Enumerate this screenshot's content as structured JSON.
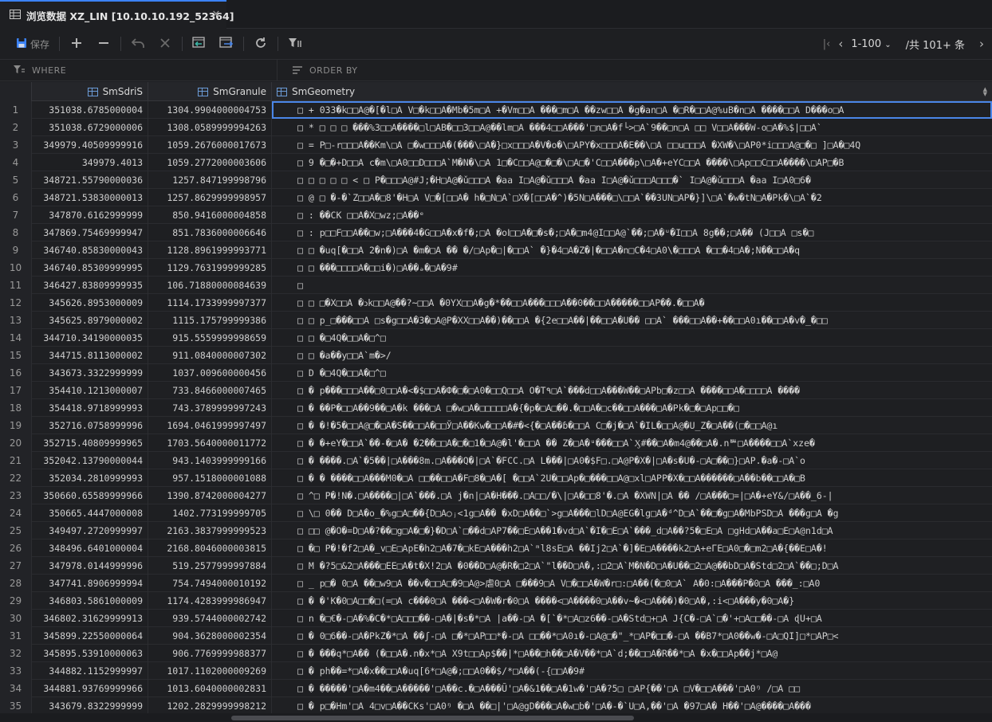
{
  "tab": {
    "title": "浏览数据 XZ_LIN [10.10.10.192_52364]",
    "icon": "table-icon",
    "close_icon": "close-icon"
  },
  "toolbar": {
    "save_label": "保存",
    "pager": {
      "range": "1-100",
      "total": "/共 101+ 条"
    }
  },
  "filter": {
    "where_label": "WHERE",
    "order_label": "ORDER BY"
  },
  "columns": [
    "SmSdriS",
    "SmGranule",
    "SmGeometry"
  ],
  "rows": [
    {
      "n": "1",
      "a": "351038.6785000004",
      "b": "1304.9904000004753",
      "c": "□    +    033�k□□A@�[�l□A V□�k□□A�Mb�5m□A +�Vm□□A ���□m□A ��zw□□A �g�an□A �□R�□□A@%uB�n□A ����□□A D���o□A"
    },
    {
      "n": "2",
      "a": "351038.6729000006",
      "b": "1308.0589999994263",
      "c": "□    *    □    □    □      ���%3□□A����□l□AB�□□3□□A@��lm□A ���4□□A���'□n□A�f└>□A`9��□n□A □□ V□□A���W-o□A�%$|□□A`"
    },
    {
      "n": "3",
      "a": "349979.40509999916",
      "b": "1059.2676000017673",
      "c": "□    =    P□-r□□□A��Km\\□A □�w□□□A�(���\\□A�}□x□□□A�V�o�\\□APY�x□□□A�E��\\□A □□u□□□A �XW�\\□AP0*i□□□A@□�□ ]□A�□4Q"
    },
    {
      "n": "4",
      "a": "349979.4013",
      "b": "1059.2772000003606",
      "c": "□    9    �□�+D□□A c�m\\□A0□□D□□□A`M�N�\\□A 1□�C□□A@□�□�\\□A□�'C□□A���p\\□A�+eYC□□A ����\\□Ap□□C□□A����\\□AP□�B"
    },
    {
      "n": "5",
      "a": "348721.55790000036",
      "b": "1257.847199998796",
      "c": "□    □    □    □    □    <    □    P�□□□A@#J;�H□A@�ǔ□□□A �aa I□A@�ǔ□□□A �aa I□A@�ǔ□□□A□□□�` I□A@�ǔ□□□A �aa I□A0□6�"
    },
    {
      "n": "6",
      "a": "348721.53830000013",
      "b": "1257.8629999998957",
      "c": "□    @    □    �-�`Z□□A�□8'�H□A V□�[□□A�    h�□N□A`□X�[□□A�^)�5N□A���□\\□□A`��3UN□AP�}]\\□A`�w�tN□A�Pk�\\□A`�2"
    },
    {
      "n": "7",
      "a": "347870.6162999999",
      "b": "850.9416000004858",
      "c": "□    :    ��CK       □□A�X□wz;□A��ᵉ"
    },
    {
      "n": "8",
      "a": "347869.75469999947",
      "b": "851.7836000006646",
      "c": "□    :    p□□F□□A��□w;□A���4�G□□A�x�f�;□A �oⅠ□□A�□�s�;□A�□m4@I□□A@`��;□A�ᵘ�I□□A 8g��;□A��       (J□□A □s�□"
    },
    {
      "n": "9",
      "a": "346740.85830000043",
      "b": "1128.8961999993771",
      "c": "□    □    �uq[�□□A 2�n�)□A �m�□A ��        �/□Ap�□|�□□A` �}�4□A�Z�|�□□A�n□C�4□A0\\�□□□A �□□�4□A�;N��□□A�q"
    },
    {
      "n": "10",
      "a": "346740.85309999995",
      "b": "1129.7631999999285",
      "c": "□    □    ���□□□□A�□□i�)□A��ₔ�□A�9#"
    },
    {
      "n": "11",
      "a": "346427.83809999935",
      "b": "106.71880000084639",
      "c": "□"
    },
    {
      "n": "12",
      "a": "345626.8953000009",
      "b": "1114.1733999997377",
      "c": "□    □     □�X□□A �ↄk□□A@��?~□□A �0YX□□A�g�*��□□A���□□□A��0��□□A�����□□AP��.�□□A�"
    },
    {
      "n": "13",
      "a": "345625.8979000002",
      "b": "1115.175799999386",
      "c": "□    □    p_□���□□A □s�g□□A�3�□A@P�XX□□A��)��□□A �{2e□□A��|��□□A�U�� □□A` ���□□A��+��□□A0ı��□□A�v�_�□□"
    },
    {
      "n": "14",
      "a": "344710.34190000035",
      "b": "915.5559999998659",
      "c": "□    □    �□4Q�□□A�□^□"
    },
    {
      "n": "15",
      "a": "344715.8113000002",
      "b": "911.0840000007302",
      "c": "□    □    �a��y□□A`m�>/"
    },
    {
      "n": "16",
      "a": "343673.3322999999",
      "b": "1037.009600000456",
      "c": "□    D    �□4Q�□□A�□^□"
    },
    {
      "n": "17",
      "a": "354410.1213000007",
      "b": "733.8466000007465",
      "c": "□    �     p���□□□A��□0□□A�<�$□□A�Ф�□�□A0�□□Q□□A O�T٩□A`���d□□A���W��□APb□�z□□A ����□□A�□□□□A ����"
    },
    {
      "n": "18",
      "a": "354418.9718999993",
      "b": "743.3789999997243",
      "c": "□    �      ��P�□□A��9��□A�k      ���□A □�w□A�□□□□□A�{�p�□A□��.�□□A�□c��□□A���□A�Pk�□�□Ap□□�□"
    },
    {
      "n": "19",
      "a": "352716.0758999996",
      "b": "1694.0461999997497",
      "c": "□    �     �!�5�□□A@□�□A�S��□□A�□□Ў□A��Kw�□□A�#�<{�□A��ɓ�□□A C□�j�□A`�IL�□□A@�U_Z�□A��(□�□□A@ı"
    },
    {
      "n": "20",
      "a": "352715.40809999965",
      "b": "1703.5640000011772",
      "c": "□    �     �+eY�□□A`��-�□A� �2��□□A�□�□1�□A@�l'�□□A �� Z�□A�ᵘ���□□A`Ӽ#��□A�m4@��□A�.nᄥ□A����□□A`xze�"
    },
    {
      "n": "21",
      "a": "352042.13790000044",
      "b": "943.1403999999166",
      "c": "□    �     ����.□A`�5��|□A���8m.□A���Q�|□A`�FCC.□A L���|□A0�$F□.□A@P�X�|□A�s�U�-□A□��□}□AP.�a�-□A`o"
    },
    {
      "n": "22",
      "a": "352034.2810999993",
      "b": "957.1518000001088",
      "c": "□    �     � ����□□A���M0�□A □□��□□A�F□8�□A�[ �□□A`2U�□□Ap�□���□□A@□xl□APP�X�□□A������□A��b��□□A�□B"
    },
    {
      "n": "23",
      "a": "350660.65589999966",
      "b": "1390.8742000004277",
      "c": "□    ^□   P�!N�.□A����□|□A`���.□A  j�n|□A�H���.□A□□/�\\|□A�□□8'�.□A �XWN|□A ��      /□A���□=|□A�+eY&/□A��_6-|"
    },
    {
      "n": "24",
      "a": "350665.4447000008",
      "b": "1402.773199999705",
      "c": "□    \\□   0��  D□A�o_�%g□A□��{D□A○ⱼ<1g□A�� �xD□A��□`>g□A���□lD□A@EG�lg□A�ᵈ^D□A`��□�g□A�MbPSD□A ���g□A �g"
    },
    {
      "n": "25",
      "a": "349497.2720999997",
      "b": "2163.3837999999523",
      "c": "□    □□    @�O�=D□A�?��□g□A�□�}�D□A`□��d□AP7��□E□A��1�vd□A`�I�□E□A`���_d□A��?5�□E□A □gHd□A��a□E□A@n1d□A"
    },
    {
      "n": "26",
      "a": "348496.6401000004",
      "b": "2168.8046000003815",
      "c": "□    �□   P�!�f2□A�_v□E□ApE�h2□A�7�□kE□A���h2□A`ᵐl8sE□A ��Ij2□A`�]�E□A����k2□A+eΓE□A0□�□m2□A�{��E□A�!"
    },
    {
      "n": "27",
      "a": "347978.0144999996",
      "b": "519.2577999997884",
      "c": "□    M    �?5□&2□A���□EE□A�t�X!2□A �0��D□A@�R�□2□A`\"l��D□A�,:□2□A`M�N�D□A�U��□2□A@��bD□A�Std□2□A`��□;D□A"
    },
    {
      "n": "28",
      "a": "347741.8906999994",
      "b": "754.7494000010192",
      "c": "□    _    p□�  0□A ��□w9□A ��v�□□A□�9□A@>虐0□A □���9□A V□�□□A�W�r□:□A��(�□0□A` A�0:□A���P�0□A ���_:□A0"
    },
    {
      "n": "29",
      "a": "346803.5861000009",
      "b": "1174.4283999986947",
      "c": "□    �     �'K�0□A□□�□(=□A c���0□A ���<□A�W�r�0□A ����<□A����0□A��v~�<□A���)�0□A�,:i<□A���y�0□A�}"
    },
    {
      "n": "30",
      "a": "346802.31629999913",
      "b": "939.5744000002742",
      "c": "□    n     �□€�-□A�%�C�*□A□□□��-□A�|�s�*□A |a��-□A �[`�*□A□z6��-□A�Std□+□A J{C�-□A`□�'+□A□□��-□A ɖU+□A"
    },
    {
      "n": "31",
      "a": "345899.22550000064",
      "b": "904.3628000002354",
      "c": "□    �     0□6��-□A�PkZ�*□A ��ʃ-□A □�*□AP□□*�-□A □□��*□A0ı�-□A@□�\"_*□AP�□□�-□A ��B7*□A0��w�-□A□QI]□*□AP□<"
    },
    {
      "n": "32",
      "a": "345895.53910000063",
      "b": "906.7769999988377",
      "c": "□    �     ���q*□A��       (�□□A�.n�x*□A X9t□□Ap$��|*□A��□h��□A�V��*□A`d;��□□A�R��*□A �x�□□Ap��j*□A@"
    },
    {
      "n": "33",
      "a": "344882.1152999997",
      "b": "1017.1102000009269",
      "c": "□    �     ph��=*□A�x��□□A�uq[6*□A@�;□□A0��$/*□A��(-{□□A�9#"
    },
    {
      "n": "34",
      "a": "344881.93769999966",
      "b": "1013.6040000002831",
      "c": "□    �     �����'□A�m4��□A�����'□A��c.�□A���Ũ'□A�&1��□A�1w�'□A�?5□ □AP{��'□A □V�□□A���'□A0ᵑ /□A □□"
    },
    {
      "n": "35",
      "a": "343679.8322999999",
      "b": "1202.2829999998212",
      "c": "□    �     p□�Hm'□A 4□v□A��CKs'□A0ᵑ �□A ��□|'□A@gD���□A�w□b�'□A�-�`U□A,��'□A �97□A� H��'□A@����□A���"
    }
  ]
}
